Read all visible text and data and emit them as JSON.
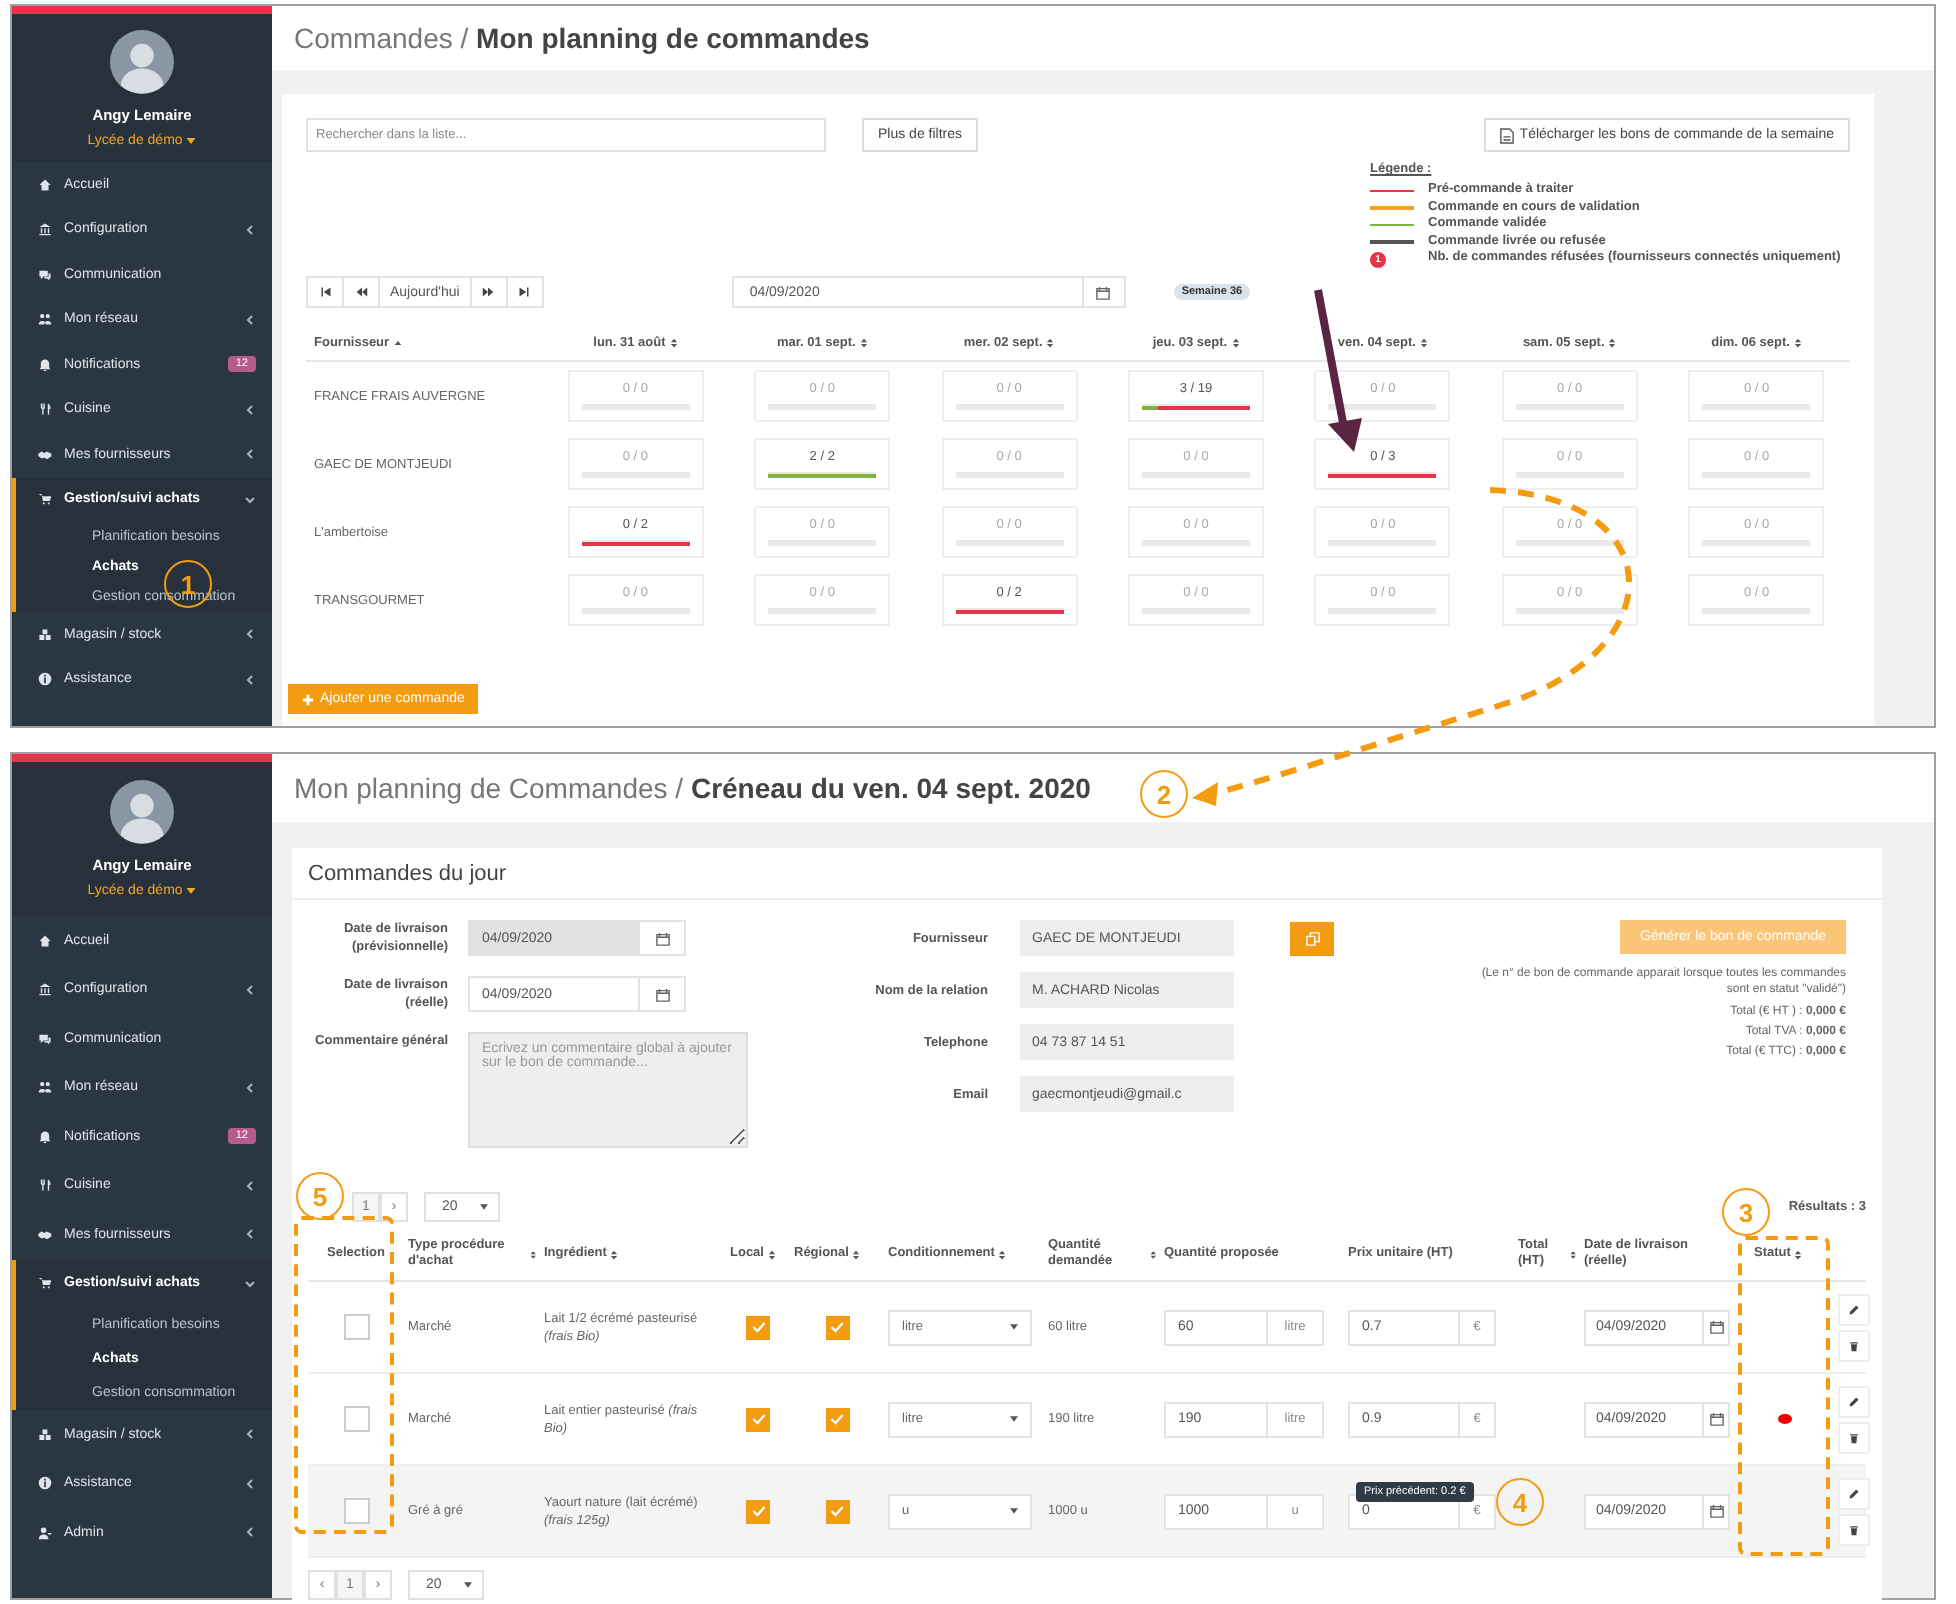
{
  "screens": [
    {
      "kind": "planning",
      "sidebar": {
        "user": "Angy Lemaire",
        "school": "Lycée de démo",
        "items": [
          {
            "label": "Accueil",
            "selected": false
          },
          {
            "label": "Configuration",
            "selected": false,
            "expanded": false
          },
          {
            "label": "Communication",
            "selected": false
          },
          {
            "label": "Mon réseau",
            "selected": false,
            "expanded": false
          },
          {
            "label": "Notifications",
            "selected": false,
            "badge": "12"
          },
          {
            "label": "Cuisine",
            "selected": false,
            "expanded": false
          },
          {
            "label": "Mes fournisseurs",
            "selected": false,
            "expanded": false
          },
          {
            "label": "Gestion/suivi achats",
            "selected": true,
            "expanded": true,
            "children": [
              {
                "label": "Planification besoins",
                "selected": false
              },
              {
                "label": "Achats",
                "selected": true
              },
              {
                "label": "Gestion consommation",
                "selected": false
              }
            ]
          },
          {
            "label": "Magasin / stock",
            "selected": false,
            "expanded": false
          },
          {
            "label": "Assistance",
            "selected": false,
            "expanded": false
          }
        ]
      },
      "breadcrumb": "Commandes / **Mon planning de commandes**",
      "search": {
        "placeholder": "Rechercher dans la liste..."
      },
      "filters_button": "Plus de filtres",
      "download_button": "Télécharger les bons de commande de la semaine",
      "legend": {
        "title": "Légende :",
        "items": [
          {
            "label": "Pré-commande à traiter",
            "color": "#e8334a"
          },
          {
            "label": "Commande en cours de validation",
            "color": "#f7a21b"
          },
          {
            "label": "Commande validée",
            "color": "#7cb342"
          },
          {
            "label": "Commande livrée ou refusée",
            "color": "#555555"
          }
        ],
        "refused": {
          "badge": "1",
          "label": "Nb. de commandes réfusées (fournisseurs connectés uniquement)"
        }
      },
      "nav": {
        "today": "Aujourd'hui",
        "date": "04/09/2020",
        "week": "Semaine 36"
      },
      "supplier_column": {
        "label": "Fournisseur",
        "sorted": true
      },
      "day_columns": [
        {
          "label": "lun. 31 août",
          "sorted": false
        },
        {
          "label": "mar. 01 sept.",
          "sorted": false
        },
        {
          "label": "mer. 02 sept.",
          "sorted": false
        },
        {
          "label": "jeu. 03 sept.",
          "sorted": false
        },
        {
          "label": "ven. 04 sept.",
          "sorted": false
        },
        {
          "label": "sam. 05 sept.",
          "sorted": false
        },
        {
          "label": "dim. 06 sept.",
          "sorted": false
        }
      ],
      "rows": [
        {
          "supplier": "FRANCE FRAIS AUVERGNE",
          "cells": [
            {
              "value": "0 / 0"
            },
            {
              "value": "0 / 0"
            },
            {
              "value": "0 / 0"
            },
            {
              "value": "3 / 19",
              "bars": [
                {
                  "color": "#7cb342",
                  "level": 0.15
                },
                {
                  "color": "#e8334a",
                  "level": 0.85
                }
              ]
            },
            {
              "value": "0 / 0"
            },
            {
              "value": "0 / 0"
            },
            {
              "value": "0 / 0"
            }
          ]
        },
        {
          "supplier": "GAEC DE MONTJEUDI",
          "cells": [
            {
              "value": "0 / 0"
            },
            {
              "value": "2 / 2",
              "bars": [
                {
                  "color": "#7cb342",
                  "level": 1
                }
              ]
            },
            {
              "value": "0 / 0"
            },
            {
              "value": "0 / 0"
            },
            {
              "value": "0 / 3",
              "bars": [
                {
                  "color": "#e8334a",
                  "level": 1
                }
              ]
            },
            {
              "value": "0 / 0"
            },
            {
              "value": "0 / 0"
            }
          ]
        },
        {
          "supplier": "L'ambertoise",
          "cells": [
            {
              "value": "0 / 2",
              "bars": [
                {
                  "color": "#e8334a",
                  "level": 1
                }
              ]
            },
            {
              "value": "0 / 0"
            },
            {
              "value": "0 / 0"
            },
            {
              "value": "0 / 0"
            },
            {
              "value": "0 / 0"
            },
            {
              "value": "0 / 0"
            },
            {
              "value": "0 / 0"
            }
          ]
        },
        {
          "supplier": "TRANSGOURMET",
          "cells": [
            {
              "value": "0 / 0"
            },
            {
              "value": "0 / 0"
            },
            {
              "value": "0 / 2",
              "bars": [
                {
                  "color": "#e8334a",
                  "level": 1
                }
              ]
            },
            {
              "value": "0 / 0"
            },
            {
              "value": "0 / 0"
            },
            {
              "value": "0 / 0"
            },
            {
              "value": "0 / 0"
            }
          ]
        }
      ],
      "add_button": "Ajouter une commande"
    },
    {
      "kind": "detail",
      "sidebar": {
        "user": "Angy Lemaire",
        "school": "Lycée de démo",
        "items": [
          {
            "label": "Accueil",
            "selected": false
          },
          {
            "label": "Configuration",
            "selected": false,
            "expanded": false
          },
          {
            "label": "Communication",
            "selected": false
          },
          {
            "label": "Mon réseau",
            "selected": false,
            "expanded": false
          },
          {
            "label": "Notifications",
            "selected": false,
            "badge": "12"
          },
          {
            "label": "Cuisine",
            "selected": false,
            "expanded": false
          },
          {
            "label": "Mes fournisseurs",
            "selected": false,
            "expanded": false
          },
          {
            "label": "Gestion/suivi achats",
            "selected": true,
            "expanded": true,
            "children": [
              {
                "label": "Planification besoins",
                "selected": false
              },
              {
                "label": "Achats",
                "selected": true
              },
              {
                "label": "Gestion consommation",
                "selected": false
              }
            ]
          },
          {
            "label": "Magasin / stock",
            "selected": false,
            "expanded": false
          },
          {
            "label": "Assistance",
            "selected": false,
            "expanded": false
          },
          {
            "label": "Admin",
            "selected": false,
            "expanded": false
          }
        ]
      },
      "breadcrumb": "Mon planning de Commandes / **Créneau du ven. 04 sept. 2020**",
      "card_title": "Commandes du jour",
      "form_left": [
        {
          "kind": "date",
          "label": "Date de livraison (prévisionnelle)",
          "value": "04/09/2020",
          "disabled": true
        },
        {
          "kind": "date",
          "label": "Date de livraison (réelle)",
          "value": "04/09/2020",
          "disabled": false
        },
        {
          "kind": "textarea",
          "label": "Commentaire général",
          "placeholder": "Ecrivez un commentaire global à ajouter sur le bon de commande...",
          "disabled": true
        }
      ],
      "form_right": [
        {
          "label": "Fournisseur",
          "value": "GAEC DE MONTJEUDI"
        },
        {
          "label": "Nom de la relation",
          "value": "M. ACHARD Nicolas"
        },
        {
          "label": "Telephone",
          "value": "04 73 87 14 51"
        },
        {
          "label": "Email",
          "value": "gaecmontjeudi@gmail.c"
        }
      ],
      "generate_button": {
        "label": "Générer le bon de commande",
        "disabled": true
      },
      "note": "(Le n° de bon de commande apparait lorsque toutes les commandes sont en statut \"validé\")",
      "totals": [
        "Total (€ HT ) : **0,000 €**",
        "Total TVA : **0,000 €**",
        "Total (€ TTC) : **0,000 €**"
      ],
      "pager_top": {
        "page": "1",
        "next": "›",
        "per_page": "20"
      },
      "results": "Résultats : 3",
      "columns": [
        {
          "label": "Selection",
          "sort": false
        },
        {
          "label": "Type procédure d'achat",
          "sort": true
        },
        {
          "label": "Ingrédient",
          "sort": true
        },
        {
          "label": "Local",
          "sort": true
        },
        {
          "label": "Régional",
          "sort": true
        },
        {
          "label": "Conditionnement",
          "sort": true
        },
        {
          "label": "Quantité demandée",
          "sort": true
        },
        {
          "label": "Quantité proposée",
          "sort": false
        },
        {
          "label": "Prix unitaire (HT)",
          "sort": false
        },
        {
          "label": "Total (HT)",
          "sort": true
        },
        {
          "label": "Date de livraison (réelle)",
          "sort": false
        },
        {
          "label": "Statut",
          "sort": true
        }
      ],
      "rows": [
        {
          "selected": false,
          "highlighted": false,
          "type": "Marché",
          "ingredient": "Lait 1/2 écrémé pasteurisé *(frais Bio)*",
          "local": true,
          "regional": true,
          "packaging": "litre",
          "requested": "60 litre",
          "proposed": "60",
          "unit": "litre",
          "price": "0.7",
          "currency": "€",
          "date": "04/09/2020",
          "flagged": false
        },
        {
          "selected": false,
          "highlighted": false,
          "type": "Marché",
          "ingredient": "Lait entier pasteurisé *(frais Bio)*",
          "local": true,
          "regional": true,
          "packaging": "litre",
          "requested": "190 litre",
          "proposed": "190",
          "unit": "litre",
          "price": "0.9",
          "currency": "€",
          "date": "04/09/2020",
          "flagged": true
        },
        {
          "selected": false,
          "highlighted": true,
          "type": "Gré à gré",
          "ingredient": "Yaourt nature (lait écrémé) *(frais 125g)*",
          "local": true,
          "regional": true,
          "packaging": "u",
          "requested": "1000 u",
          "proposed": "1000",
          "unit": "u",
          "price": "0",
          "currency": "€",
          "date": "04/09/2020",
          "flagged": false,
          "tooltip": "Prix précédent: 0.2 €"
        }
      ],
      "pager_bottom": {
        "prev": "‹",
        "page": "1",
        "next": "›",
        "per_page": "20"
      }
    }
  ],
  "annotations": [
    "1",
    "2",
    "3",
    "4",
    "5"
  ]
}
